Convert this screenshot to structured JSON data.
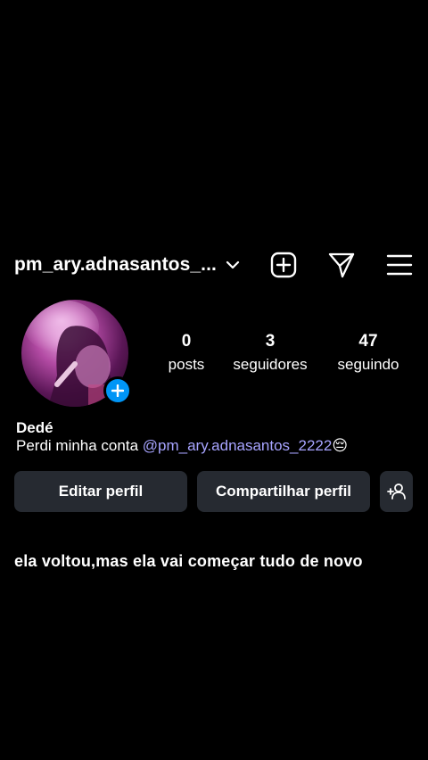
{
  "header": {
    "username": "pm_ary.adnasantos_...",
    "icons": [
      "chevron-down-icon",
      "new-post-icon",
      "direct-message-icon",
      "menu-icon"
    ]
  },
  "profile": {
    "avatar_badge_icon": "plus-icon",
    "stats": [
      {
        "value": "0",
        "label": "posts"
      },
      {
        "value": "3",
        "label": "seguidores"
      },
      {
        "value": "47",
        "label": "seguindo"
      }
    ],
    "name": "Dedé",
    "bio_text": "Perdi minha conta ",
    "bio_mention": "@pm_ary.adnasantos_2222",
    "bio_emoji": "😔"
  },
  "actions": {
    "edit_label": "Editar perfil",
    "share_label": "Compartilhar perfil",
    "discover_icon": "add-person-icon"
  },
  "overlay": {
    "caption": "ela voltou,mas ela vai começar tudo de novo"
  },
  "colors": {
    "background": "#000000",
    "button": "#262a31",
    "mention": "#a7a4ff",
    "badge": "#0095f6"
  }
}
